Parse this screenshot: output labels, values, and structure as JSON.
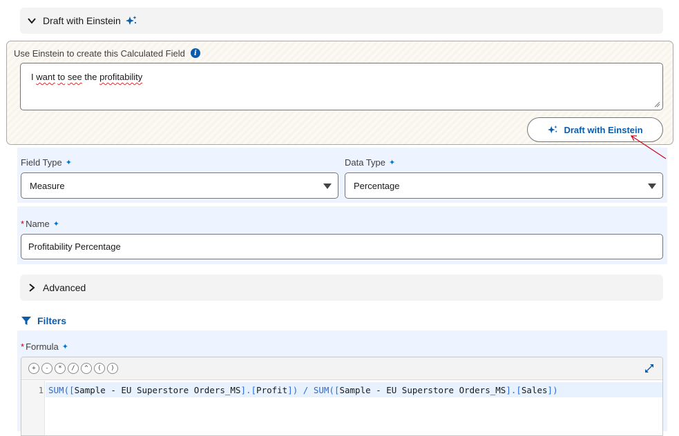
{
  "draft_section": {
    "header_label": "Draft with Einstein",
    "icons": {
      "chevron": "chevron-down-icon",
      "sparkle": "einstein-sparkle-icon"
    }
  },
  "einstein_panel": {
    "label": "Use Einstein to create this Calculated Field",
    "info_icon": "info-icon",
    "prompt_words": [
      "I",
      "want",
      "to",
      "see",
      "the",
      "profitability"
    ],
    "button_label": "Draft with Einstein"
  },
  "field_type": {
    "label": "Field Type",
    "value": "Measure"
  },
  "data_type": {
    "label": "Data Type",
    "value": "Percentage"
  },
  "name": {
    "required_mark": "*",
    "label": "Name",
    "value": "Profitability Percentage"
  },
  "advanced": {
    "label": "Advanced"
  },
  "filters": {
    "label": "Filters"
  },
  "formula": {
    "required_mark": "*",
    "label": "Formula",
    "operators": [
      "+",
      "-",
      "*",
      "/",
      "^",
      "(",
      ")"
    ],
    "line_number": "1",
    "tokens": {
      "fn1": "SUM",
      "open1": "(",
      "lb1": "[",
      "t1": "Sample - EU Superstore Orders_MS",
      "mid1": "].[",
      "t2": "Profit",
      "rb1": "]",
      "close1": ")",
      "div": " / ",
      "fn2": "SUM",
      "open2": "(",
      "lb2": "[",
      "t3": "Sample - EU Superstore Orders_MS",
      "mid2": "].[",
      "t4": "Sales",
      "rb2": "]",
      "close2": ")"
    }
  },
  "colors": {
    "accent": "#0b5cab",
    "required": "#ba0517",
    "section_bg": "#eef4ff",
    "annotation_arrow": "#d0021b"
  }
}
